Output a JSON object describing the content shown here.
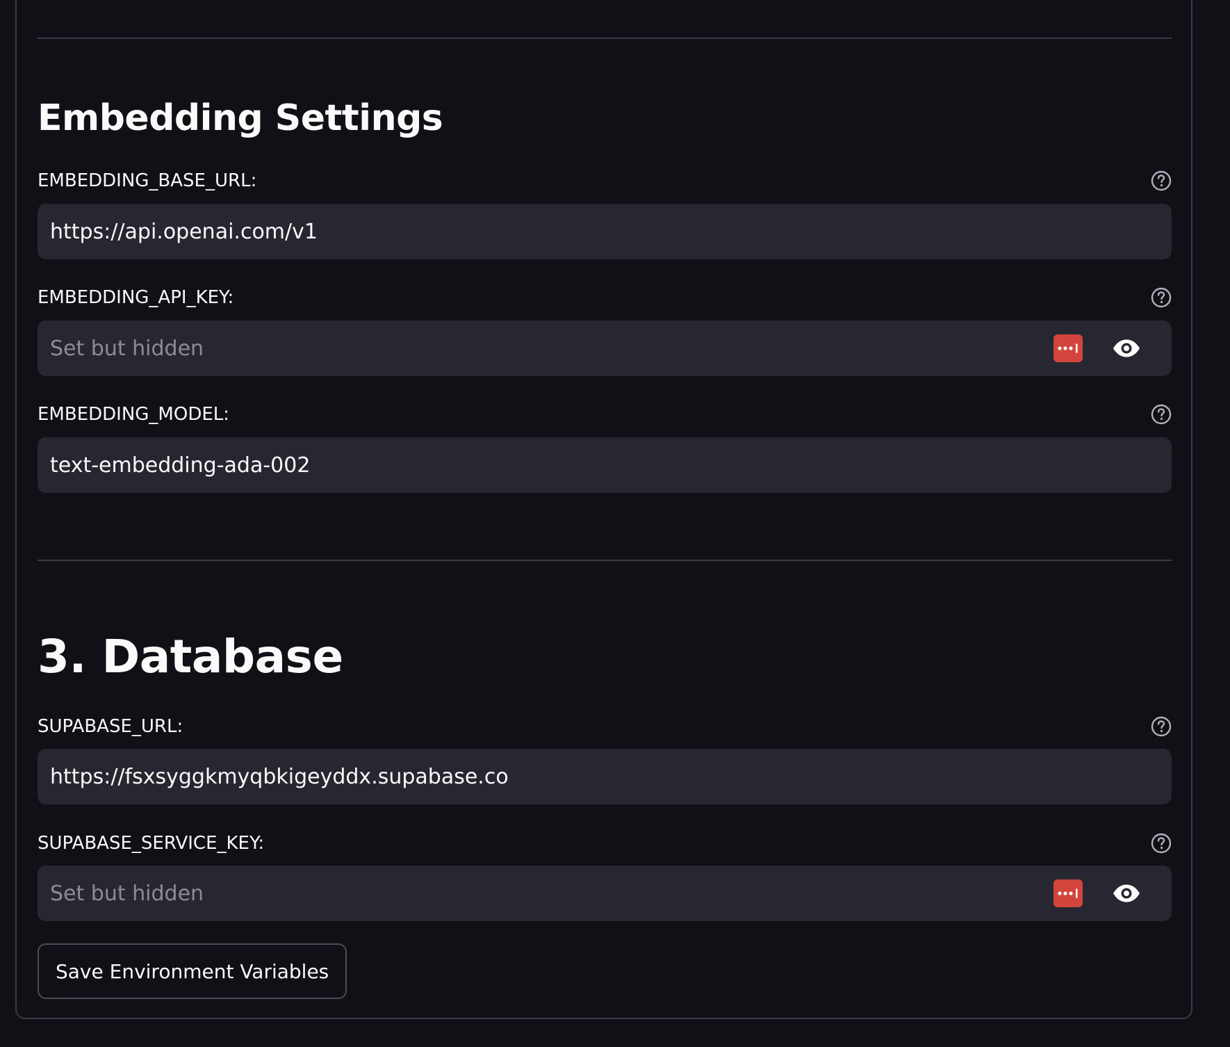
{
  "embedding": {
    "heading": "Embedding Settings",
    "base_url": {
      "label": "EMBEDDING_BASE_URL:",
      "value": "https://api.openai.com/v1"
    },
    "api_key": {
      "label": "EMBEDDING_API_KEY:",
      "placeholder": "Set but hidden"
    },
    "model": {
      "label": "EMBEDDING_MODEL:",
      "value": "text-embedding-ada-002"
    }
  },
  "database": {
    "heading": "3. Database",
    "supabase_url": {
      "label": "SUPABASE_URL:",
      "value": "https://fsxsyggkmyqbkigeyddx.supabase.co"
    },
    "service_key": {
      "label": "SUPABASE_SERVICE_KEY:",
      "placeholder": "Set but hidden"
    }
  },
  "actions": {
    "save_label": "Save Environment Variables"
  },
  "colors": {
    "background": "#0f1117",
    "input_background": "#262730",
    "password_manager_accent": "#d2453d"
  },
  "icons": {
    "help": "question-circle-icon",
    "password_manager": "password-manager-icon",
    "reveal": "eye-icon"
  }
}
